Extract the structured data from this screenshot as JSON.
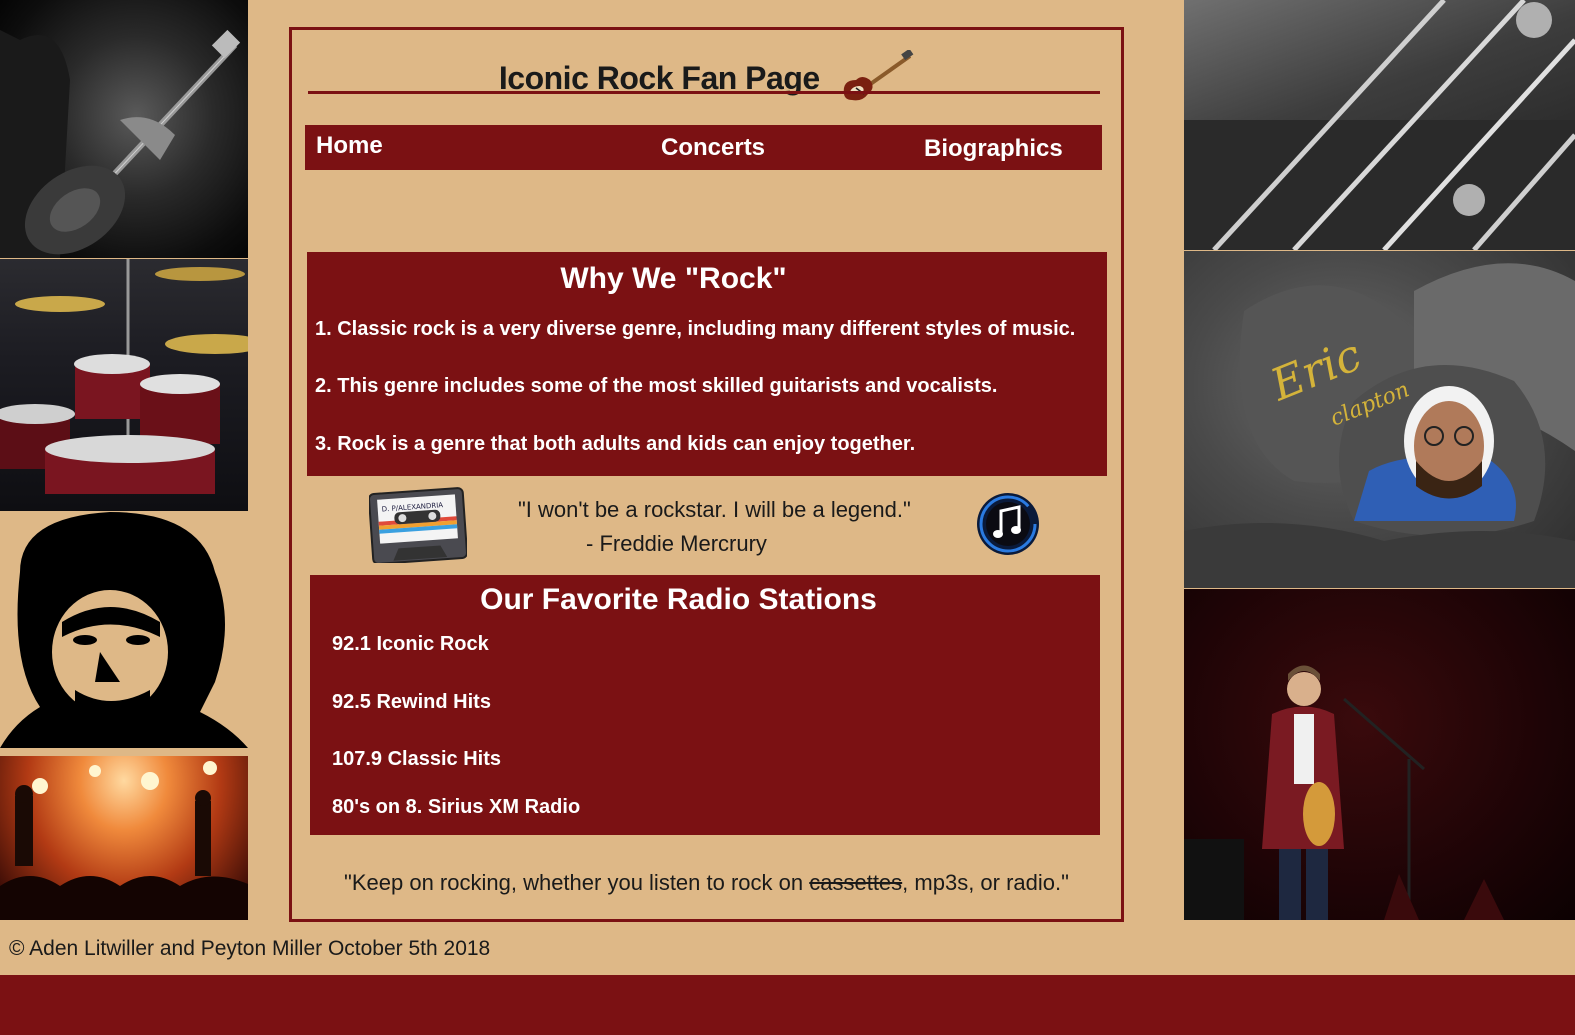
{
  "header": {
    "title": "Iconic Rock Fan Page",
    "icon": "electric-guitar-icon"
  },
  "nav": {
    "home": "Home",
    "concerts": "Concerts",
    "biographics": "Biographics"
  },
  "why": {
    "heading": "Why We \"Rock\"",
    "items": [
      "1. Classic rock is a very diverse genre, including many different styles of music.",
      "2. This genre includes some of the most skilled guitarists and vocalists.",
      "3. Rock is a genre that both adults and kids can enjoy together."
    ]
  },
  "quote": {
    "text": "\"I won't be a rockstar.  I will be a legend.\"",
    "author": "- Freddie Mercrury",
    "left_icon": "cassette-tape-icon",
    "right_icon": "music-note-icon",
    "cassette_label": "D. P/ALEXANDRIA"
  },
  "radio": {
    "heading": "Our Favorite Radio Stations",
    "stations": [
      "92.1 Iconic Rock",
      "92.5 Rewind Hits",
      "107.9 Classic Hits",
      "80's on 8. Sirius XM Radio"
    ]
  },
  "closing": {
    "before": "\"Keep on rocking, whether you listen to rock on ",
    "struck": "cassettes",
    "after": ", mp3s, or radio.\""
  },
  "footer": {
    "text": "© Aden Litwiller and Peyton Miller October 5th 2018"
  },
  "photos": {
    "rock_painting_text_1": "Eric",
    "rock_painting_text_2": "clapton"
  },
  "colors": {
    "background": "#deb887",
    "accent": "#7b1113",
    "text": "#1a1a1a"
  }
}
